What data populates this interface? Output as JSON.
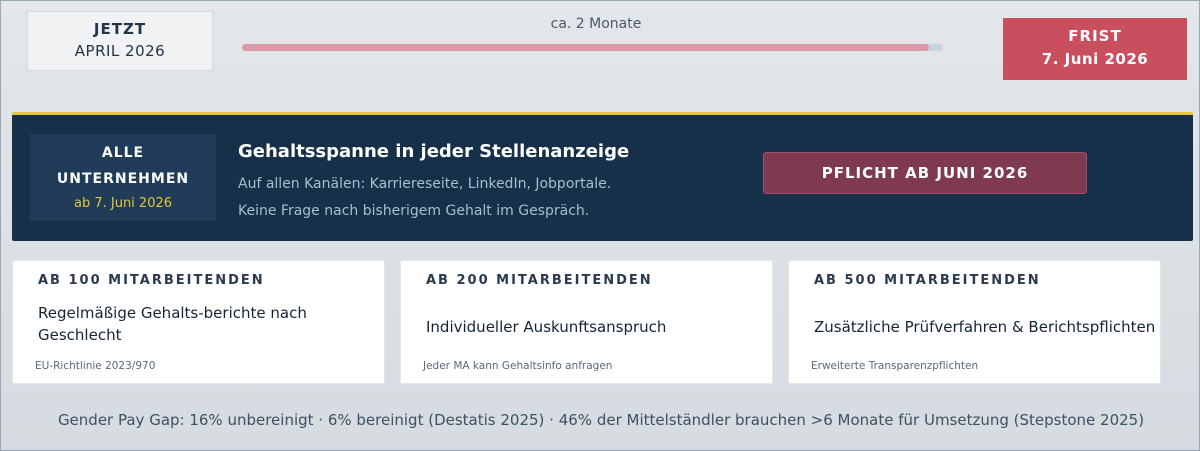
{
  "timeline": {
    "now_label": "JETZT",
    "now_date": "APRIL 2026",
    "duration": "ca. 2 Monate",
    "progress": 0.98,
    "deadline_label": "FRIST",
    "deadline_date": "7. Juni 2026"
  },
  "banner": {
    "scope_line1": "ALLE",
    "scope_line2": "UNTERNEHMEN",
    "scope_date": "ab 7. Juni 2026",
    "title": "Gehaltsspanne in jeder Stellenanzeige",
    "line1": "Auf allen Kanälen: Karriereseite, LinkedIn, Jobportale.",
    "line2": "Keine Frage nach bisherigem Gehalt im Gespräch.",
    "button": "PFLICHT AB JUNI 2026"
  },
  "cards": [
    {
      "label": "AB 100 MITARBEITENDEN",
      "body": "Regelmäßige Gehalts-berichte nach Geschlecht",
      "note": "EU-Richtlinie 2023/970"
    },
    {
      "label": "AB 200 MITARBEITENDEN",
      "body": "Individueller Auskunftsanspruch",
      "note": "Jeder MA kann Gehaltsinfo anfragen"
    },
    {
      "label": "AB 500 MITARBEITENDEN",
      "body": "Zusätzliche Prüfverfahren & Berichtspflichten",
      "note": "Erweiterte Transparenzpflichten"
    }
  ],
  "footer": "Gender Pay Gap: 16% unbereinigt · 6% bereinigt (Destatis 2025) · 46% der Mittelständler brauchen >6 Monate für Umsetzung (Stepstone 2025)",
  "colors": {
    "deadline": "#c94f5e",
    "banner": "#16304a",
    "accent": "#e6c53a",
    "progress": "#d99aa6"
  }
}
